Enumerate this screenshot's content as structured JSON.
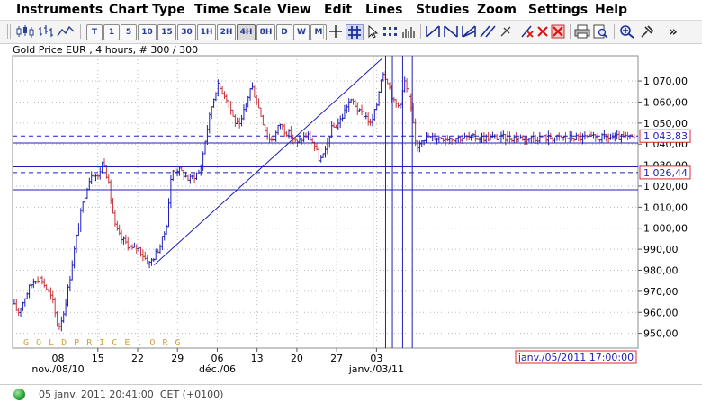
{
  "menu": {
    "instruments": "Instruments",
    "chart_type": "Chart Type",
    "time_scale": "Time Scale",
    "view": "View",
    "edit": "Edit",
    "lines": "Lines",
    "studies": "Studies",
    "zoom": "Zoom",
    "settings": "Settings",
    "help": "Help"
  },
  "toolbar": {
    "timeframes": [
      "T",
      "1",
      "5",
      "10",
      "15",
      "30",
      "1H",
      "2H",
      "4H",
      "8H",
      "D",
      "W",
      "M"
    ],
    "selected_timeframe": "4H",
    "icons": [
      "crosshair-icon",
      "grid-icon",
      "cursor-icon",
      "dots-icon",
      "volume-icon",
      "trend-line-icon",
      "parallel-lines-icon",
      "fan-icon",
      "channel-icon",
      "freehand-icon",
      "delete-line-icon",
      "delete-all-icon",
      "print-icon",
      "preview-icon",
      "zoom-icon",
      "pin-icon",
      "more-icon"
    ],
    "more_symbol": "»"
  },
  "chart_title": "Gold Price EUR , 4 hours, # 300 / 300",
  "watermark": "G O L D P R I C E . O R G",
  "colors": {
    "line": "#1f1fb8",
    "candle": "#1f1fb8",
    "bear_candle": "#c8343c",
    "box_border": "#d8292f",
    "status_green": "#2fa53a"
  },
  "chart_data": {
    "type": "ohlc",
    "title": "Gold Price EUR , 4 hours, # 300 / 300",
    "ylim": [
      943,
      1082
    ],
    "y_ticks": [
      950,
      960,
      970,
      980,
      990,
      1000,
      1010,
      1020,
      1030,
      1040,
      1050,
      1060,
      1070
    ],
    "y_tick_labels": [
      "950,00",
      "960,00",
      "970,00",
      "980,00",
      "990,00",
      "1 000,00",
      "1 010,00",
      "1 020,00",
      "1 030,00",
      "1 040,00",
      "1 050,00",
      "1 060,00",
      "1 070,00"
    ],
    "x_range": [
      0,
      110
    ],
    "x_ticks": [
      {
        "x": 8,
        "label": "08"
      },
      {
        "x": 15,
        "label": "15"
      },
      {
        "x": 22,
        "label": "22"
      },
      {
        "x": 29,
        "label": "29"
      },
      {
        "x": 36,
        "label": "06"
      },
      {
        "x": 43,
        "label": "13"
      },
      {
        "x": 50,
        "label": "20"
      },
      {
        "x": 57,
        "label": "27"
      },
      {
        "x": 64,
        "label": "03"
      }
    ],
    "month_labels": [
      {
        "x": 8,
        "label": "nov./08/10"
      },
      {
        "x": 36,
        "label": "déc./06"
      },
      {
        "x": 64,
        "label": "janv./03/11"
      }
    ],
    "grid": true,
    "grid_style": "dotted",
    "price_markers": [
      {
        "value": 1043.83,
        "label": "1 043,83"
      },
      {
        "value": 1026.44,
        "label": "1 026,44"
      }
    ],
    "cursor_time_label": "janv./05/2011 17:00:00",
    "horizontal_lines": [
      {
        "value": 1043.83,
        "style": "dashed"
      },
      {
        "value": 1026.44,
        "style": "dashed"
      },
      {
        "value": 1040.5,
        "style": "solid"
      },
      {
        "value": 1029.2,
        "style": "solid"
      },
      {
        "value": 1018.3,
        "style": "solid"
      }
    ],
    "vertical_lines": [
      63.4,
      65.6,
      66.8,
      68.6,
      70.3
    ],
    "trend_lines": [
      {
        "x1": 24.9,
        "y1": 982.5,
        "x2": 64.9,
        "y2": 1080.5
      }
    ],
    "anchors": [
      [
        0,
        964
      ],
      [
        1,
        960
      ],
      [
        2,
        966
      ],
      [
        3,
        972
      ],
      [
        4,
        976
      ],
      [
        5,
        976
      ],
      [
        6,
        971
      ],
      [
        7,
        966
      ],
      [
        8,
        952
      ],
      [
        9,
        960
      ],
      [
        10,
        975
      ],
      [
        11,
        992
      ],
      [
        12,
        1007
      ],
      [
        13,
        1019
      ],
      [
        14,
        1027
      ],
      [
        15,
        1024
      ],
      [
        16,
        1033
      ],
      [
        17,
        1019
      ],
      [
        18,
        1001
      ],
      [
        19,
        995
      ],
      [
        20,
        993
      ],
      [
        21,
        990
      ],
      [
        22,
        991
      ],
      [
        23,
        987
      ],
      [
        24,
        983
      ],
      [
        25,
        987
      ],
      [
        26,
        992
      ],
      [
        27,
        1000
      ],
      [
        28,
        1027
      ],
      [
        29,
        1028
      ],
      [
        30,
        1026
      ],
      [
        31,
        1023
      ],
      [
        32,
        1025
      ],
      [
        33,
        1027
      ],
      [
        34,
        1044
      ],
      [
        35,
        1058
      ],
      [
        36,
        1068
      ],
      [
        37,
        1065
      ],
      [
        38,
        1060
      ],
      [
        39,
        1051
      ],
      [
        40,
        1048
      ],
      [
        41,
        1059
      ],
      [
        42,
        1068
      ],
      [
        43,
        1060
      ],
      [
        44,
        1051
      ],
      [
        45,
        1042
      ],
      [
        46,
        1043
      ],
      [
        47,
        1050
      ],
      [
        48,
        1046
      ],
      [
        49,
        1044
      ],
      [
        50,
        1040
      ],
      [
        51,
        1043
      ],
      [
        52,
        1044
      ],
      [
        53,
        1040
      ],
      [
        54,
        1032
      ],
      [
        55,
        1036
      ],
      [
        56,
        1047
      ],
      [
        57,
        1049
      ],
      [
        58,
        1053
      ],
      [
        59,
        1060
      ],
      [
        60,
        1060
      ],
      [
        61,
        1055
      ],
      [
        62,
        1054
      ],
      [
        63,
        1049
      ],
      [
        64,
        1058
      ],
      [
        65,
        1075
      ],
      [
        66,
        1070
      ],
      [
        67,
        1060
      ],
      [
        68,
        1058
      ],
      [
        69,
        1070
      ],
      [
        70,
        1058
      ],
      [
        71,
        1038
      ],
      [
        72,
        1043
      ]
    ]
  },
  "status": {
    "datetime": "05 janv. 2011 20:41:00",
    "timezone": "CET (+0100)"
  }
}
